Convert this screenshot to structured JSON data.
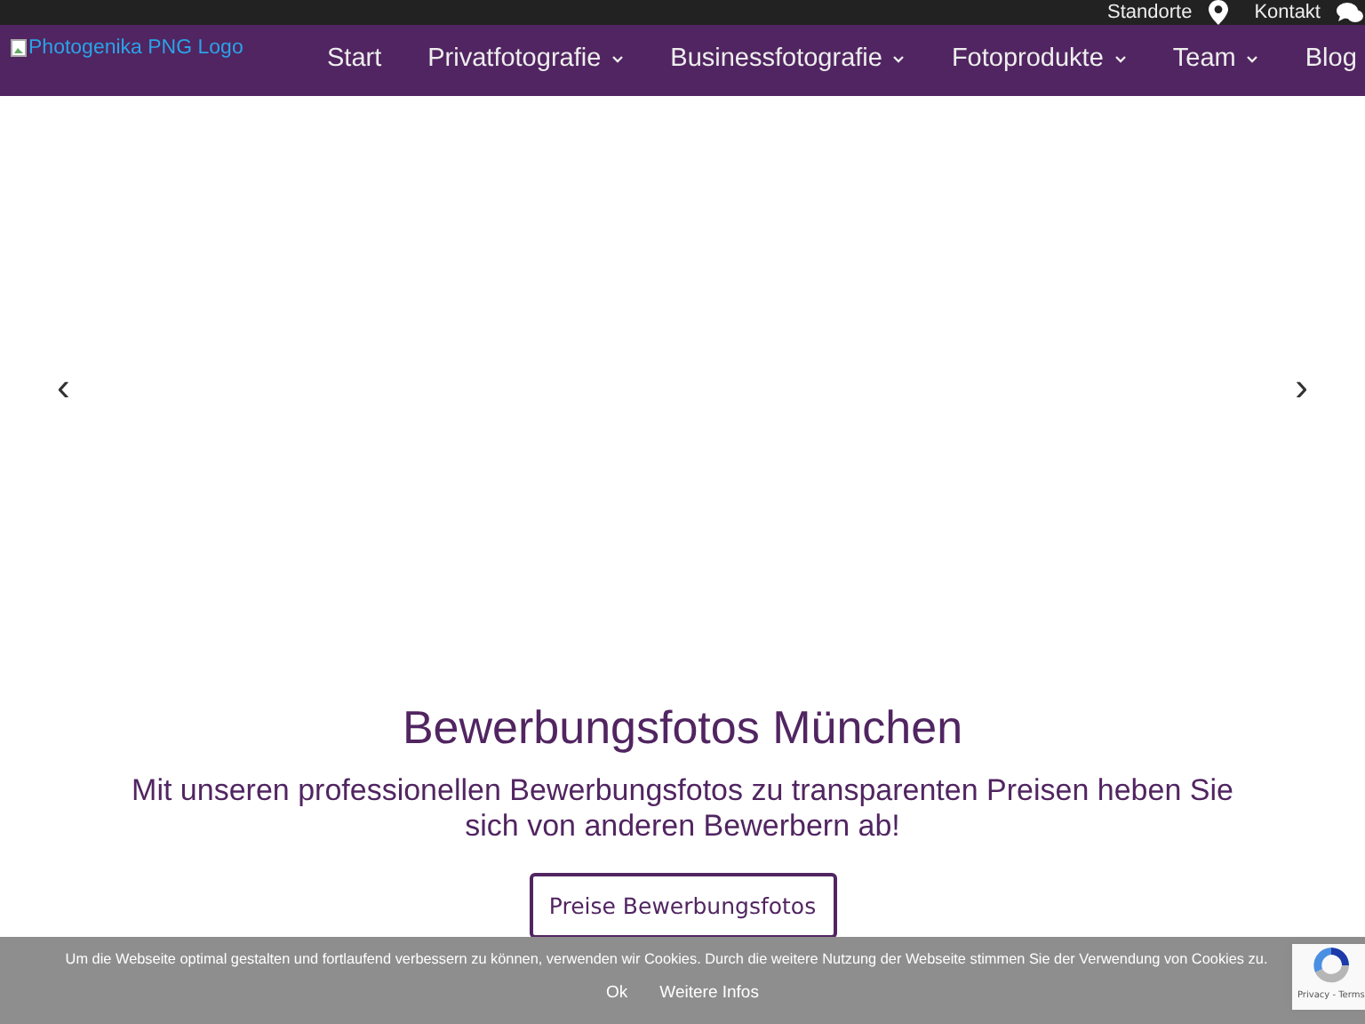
{
  "topbar": {
    "links": [
      {
        "label": "Standorte",
        "kind": "pin"
      },
      {
        "label": "Kontakt",
        "kind": "chat"
      }
    ]
  },
  "logo": {
    "alt": "Photogenika PNG Logo"
  },
  "nav": [
    {
      "label": "Start",
      "dropdown": false
    },
    {
      "label": "Privatfotografie",
      "dropdown": true
    },
    {
      "label": "Businessfotografie",
      "dropdown": true
    },
    {
      "label": "Fotoprodukte",
      "dropdown": true
    },
    {
      "label": "Team",
      "dropdown": true
    },
    {
      "label": "Blog",
      "dropdown": false
    }
  ],
  "slider": {
    "prev": "‹",
    "next": "›"
  },
  "hero": {
    "title": "Bewerbungsfotos München",
    "subtitle": "Mit unseren professionellen Bewerbungsfotos zu transparenten Preisen heben Sie sich von anderen Bewerbern ab!",
    "button": "Preise Bewerbungsfotos"
  },
  "cookie_bar": {
    "text": "Um die Webseite optimal gestalten und fortlaufend verbessern zu können, verwenden wir Cookies. Durch die weitere Nutzung der Webseite stimmen Sie der Verwendung von Cookies zu.",
    "buttons": [
      "Ok",
      "Weitere Infos"
    ]
  },
  "recaptcha": {
    "text": "Privacy - Terms"
  }
}
